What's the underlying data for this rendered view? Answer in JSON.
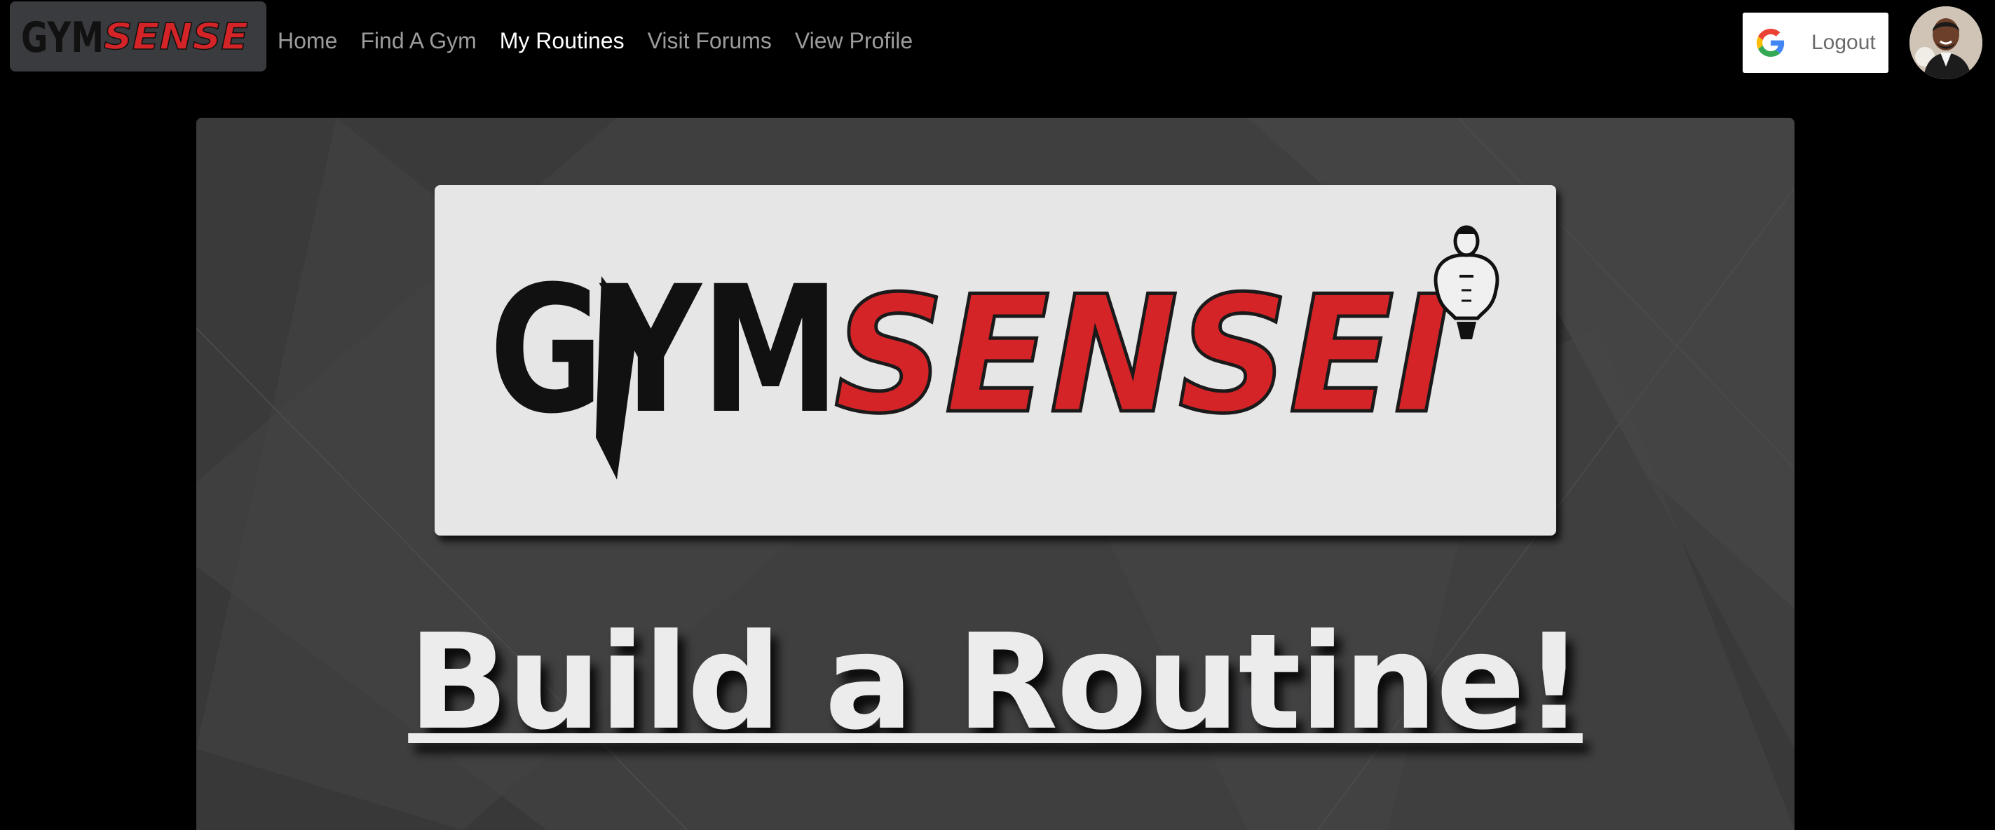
{
  "brand": {
    "logo_text_dark": "GYM",
    "logo_text_red": "SENSE"
  },
  "nav": {
    "items": [
      {
        "label": "Home",
        "active": false
      },
      {
        "label": "Find A Gym",
        "active": false
      },
      {
        "label": "My Routines",
        "active": true
      },
      {
        "label": "Visit Forums",
        "active": false
      },
      {
        "label": "View Profile",
        "active": false
      }
    ]
  },
  "auth": {
    "button_label": "Logout",
    "provider_icon": "google-icon"
  },
  "user": {
    "avatar_icon": "user-avatar"
  },
  "hero": {
    "logo_text_dark": "GYM",
    "logo_text_red": "SENSEI",
    "title": "Build a Routine!"
  },
  "colors": {
    "brand_red": "#d42427",
    "brand_dark": "#111111",
    "nav_text": "#9c9c9c",
    "nav_active": "#ffffff",
    "hero_bg": "#3f3f40",
    "logo_card_bg": "#e6e6e6"
  }
}
